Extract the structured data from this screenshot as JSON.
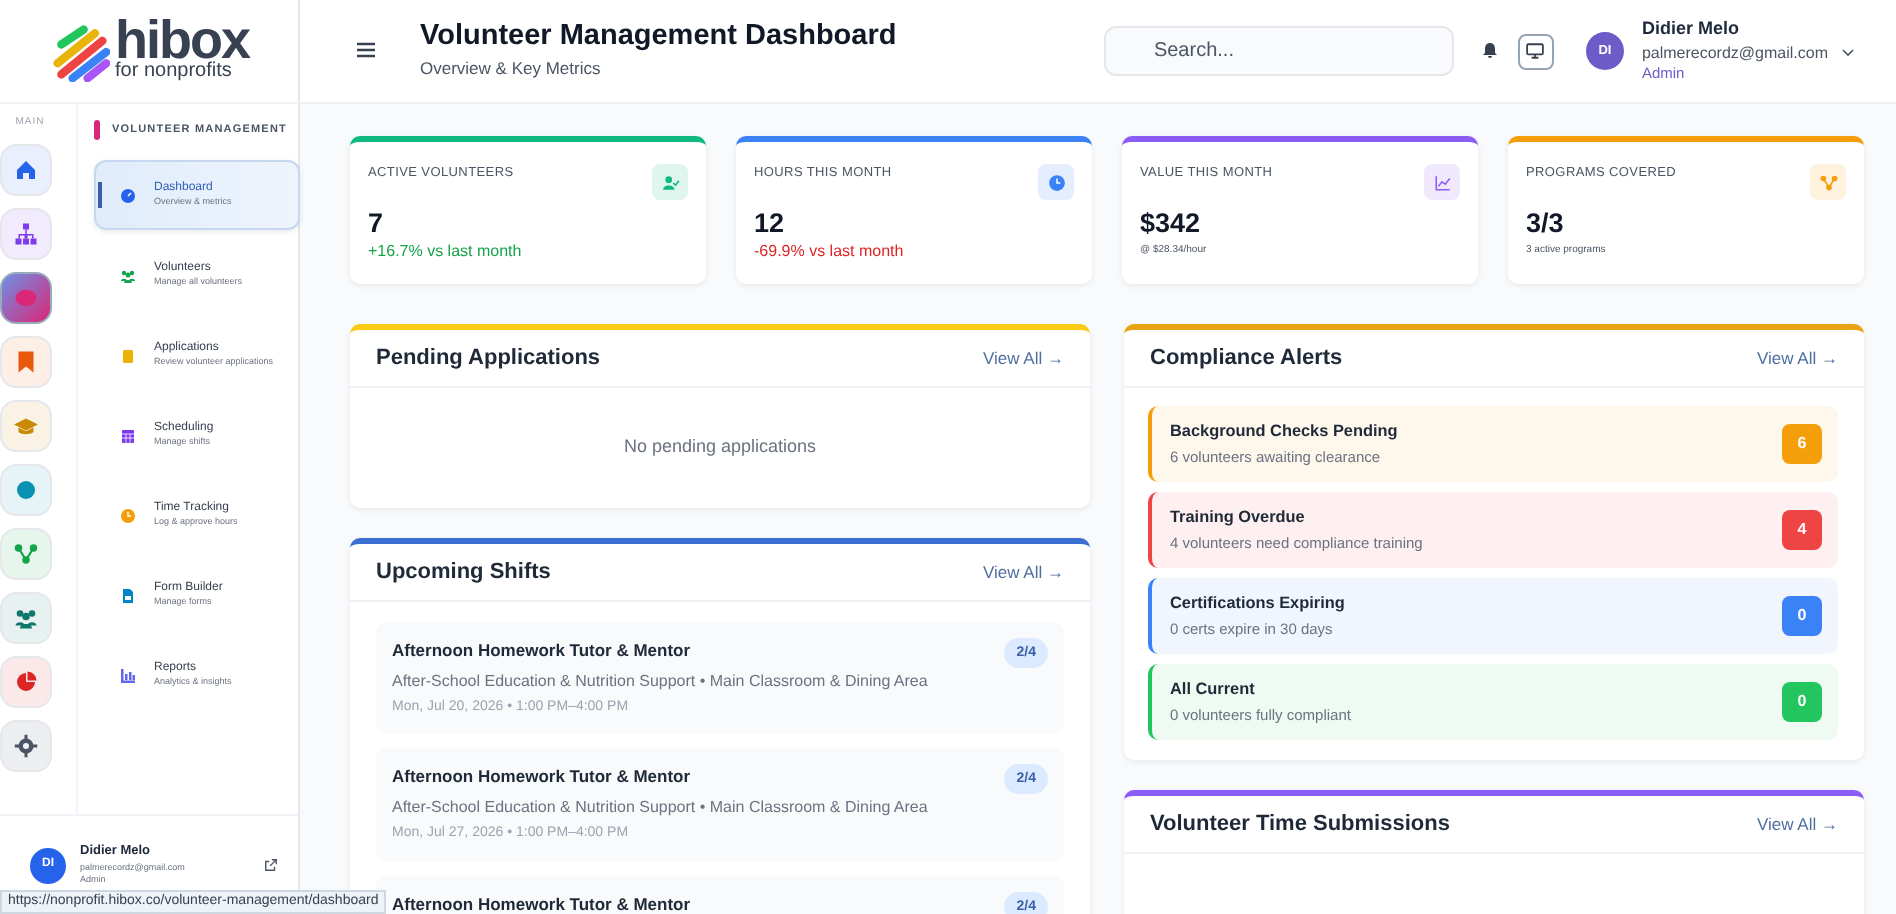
{
  "logo": {
    "name": "hibox",
    "tagline": "for nonprofits"
  },
  "rail": {
    "label": "MAIN",
    "items": [
      {
        "color": "#2563eb",
        "selected": false
      },
      {
        "color": "#7c3aed",
        "selected": false
      },
      {
        "color": "#db2777",
        "selected": true
      },
      {
        "color": "#ea580c",
        "selected": false
      },
      {
        "color": "#ca8a04",
        "selected": false
      },
      {
        "color": "#0891b2",
        "selected": false
      },
      {
        "color": "#16a34a",
        "selected": false
      },
      {
        "color": "#0f766e",
        "selected": false
      },
      {
        "color": "#dc2626",
        "selected": false
      },
      {
        "color": "#4b5563",
        "selected": false
      }
    ]
  },
  "submenu": {
    "title": "VOLUNTEER MANAGEMENT",
    "items": [
      {
        "label": "Dashboard",
        "subtitle": "Overview & metrics",
        "color": "#2563eb",
        "selected": true
      },
      {
        "label": "Volunteers",
        "subtitle": "Manage all volunteers",
        "color": "#16a34a",
        "selected": false
      },
      {
        "label": "Applications",
        "subtitle": "Review volunteer applications",
        "color": "#eab308",
        "selected": false
      },
      {
        "label": "Scheduling",
        "subtitle": "Manage shifts",
        "color": "#7c3aed",
        "selected": false
      },
      {
        "label": "Time Tracking",
        "subtitle": "Log & approve hours",
        "color": "#f59e0b",
        "selected": false
      },
      {
        "label": "Form Builder",
        "subtitle": "Manage forms",
        "color": "#0284c7",
        "selected": false
      },
      {
        "label": "Reports",
        "subtitle": "Analytics & insights",
        "color": "#6366f1",
        "selected": false
      }
    ]
  },
  "sidebar_user": {
    "initials": "DI",
    "name": "Didier Melo",
    "email": "palmerecordz@gmail.com",
    "role": "Admin"
  },
  "header": {
    "title": "Volunteer Management Dashboard",
    "subtitle": "Overview & Key Metrics",
    "search": {
      "placeholder": "Search..."
    },
    "user": {
      "initials": "DI",
      "name": "Didier Melo",
      "email": "palmerecordz@gmail.com",
      "role": "Admin"
    }
  },
  "stats": [
    {
      "label": "ACTIVE VOLUNTEERS",
      "value": "7",
      "note": "+16.7% vs last month",
      "kind": "up",
      "color": "#10b981"
    },
    {
      "label": "HOURS THIS MONTH",
      "value": "12",
      "note": "-69.9% vs last month",
      "kind": "down",
      "color": "#3b82f6"
    },
    {
      "label": "VALUE THIS MONTH",
      "value": "$342",
      "note": "@ $28.34/hour",
      "kind": "note",
      "color": "#8b5cf6"
    },
    {
      "label": "PROGRAMS COVERED",
      "value": "3/3",
      "note": "3 active programs",
      "kind": "note",
      "color": "#f59e0b"
    }
  ],
  "pending_applications": {
    "title": "Pending Applications",
    "link": "View All →",
    "empty": "No pending applications"
  },
  "upcoming_shifts": {
    "title": "Upcoming Shifts",
    "link": "View All →",
    "shifts": [
      {
        "title": "Afternoon Homework Tutor & Mentor",
        "detail": "After-School Education & Nutrition Support • Main Classroom & Dining Area",
        "when": "Mon, Jul 20, 2026 • 1:00 PM–4:00 PM",
        "filled": "2/4"
      },
      {
        "title": "Afternoon Homework Tutor & Mentor",
        "detail": "After-School Education & Nutrition Support • Main Classroom & Dining Area",
        "when": "Mon, Jul 27, 2026 • 1:00 PM–4:00 PM",
        "filled": "2/4"
      },
      {
        "title": "Afternoon Homework Tutor & Mentor",
        "filled": "2/4"
      }
    ]
  },
  "compliance_alerts": {
    "title": "Compliance Alerts",
    "link": "View All →",
    "alerts": [
      {
        "title": "Background Checks Pending",
        "detail": "6 volunteers awaiting clearance",
        "count": "6",
        "color": "#f59e0b"
      },
      {
        "title": "Training Overdue",
        "detail": "4 volunteers need compliance training",
        "count": "4",
        "color": "#ef4444"
      },
      {
        "title": "Certifications Expiring",
        "detail": "0 certs expire in 30 days",
        "count": "0",
        "color": "#3b82f6"
      },
      {
        "title": "All Current",
        "detail": "0 volunteers fully compliant",
        "count": "0",
        "color": "#22c55e"
      }
    ]
  },
  "time_submissions": {
    "title": "Volunteer Time Submissions",
    "link": "View All →"
  },
  "status_bar": {
    "url": "https://nonprofit.hibox.co/volunteer-management/dashboard"
  }
}
